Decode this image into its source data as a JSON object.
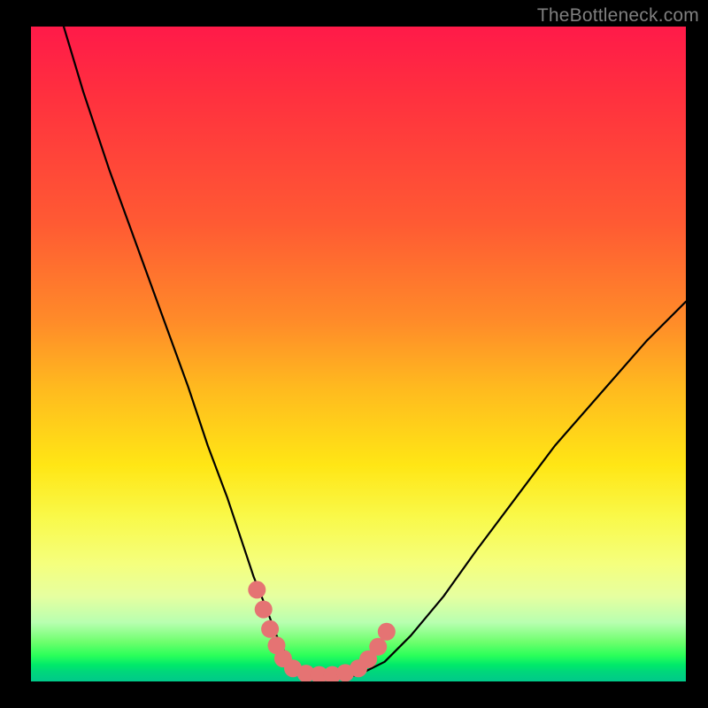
{
  "watermark": "TheBottleneck.com",
  "chart_data": {
    "type": "line",
    "title": "",
    "xlabel": "",
    "ylabel": "",
    "xlim": [
      0,
      100
    ],
    "ylim": [
      0,
      100
    ],
    "series": [
      {
        "name": "curve",
        "x": [
          5,
          8,
          12,
          16,
          20,
          24,
          27,
          30,
          32,
          34,
          36,
          37.5,
          39,
          40.5,
          42,
          44,
          47,
          50,
          54,
          58,
          63,
          68,
          74,
          80,
          87,
          94,
          100
        ],
        "y": [
          100,
          90,
          78,
          67,
          56,
          45,
          36,
          28,
          22,
          16,
          11,
          7,
          4,
          2,
          1,
          0.5,
          0.5,
          1,
          3,
          7,
          13,
          20,
          28,
          36,
          44,
          52,
          58
        ]
      }
    ],
    "markers": {
      "name": "highlight-dots",
      "color": "#e57373",
      "points": [
        {
          "x": 34.5,
          "y": 14
        },
        {
          "x": 35.5,
          "y": 11
        },
        {
          "x": 36.5,
          "y": 8
        },
        {
          "x": 37.5,
          "y": 5.5
        },
        {
          "x": 38.5,
          "y": 3.5
        },
        {
          "x": 40,
          "y": 2
        },
        {
          "x": 42,
          "y": 1.2
        },
        {
          "x": 44,
          "y": 1
        },
        {
          "x": 46,
          "y": 1
        },
        {
          "x": 48,
          "y": 1.3
        },
        {
          "x": 50,
          "y": 2
        },
        {
          "x": 51.5,
          "y": 3.4
        },
        {
          "x": 53,
          "y": 5.3
        },
        {
          "x": 54.3,
          "y": 7.6
        }
      ]
    }
  }
}
